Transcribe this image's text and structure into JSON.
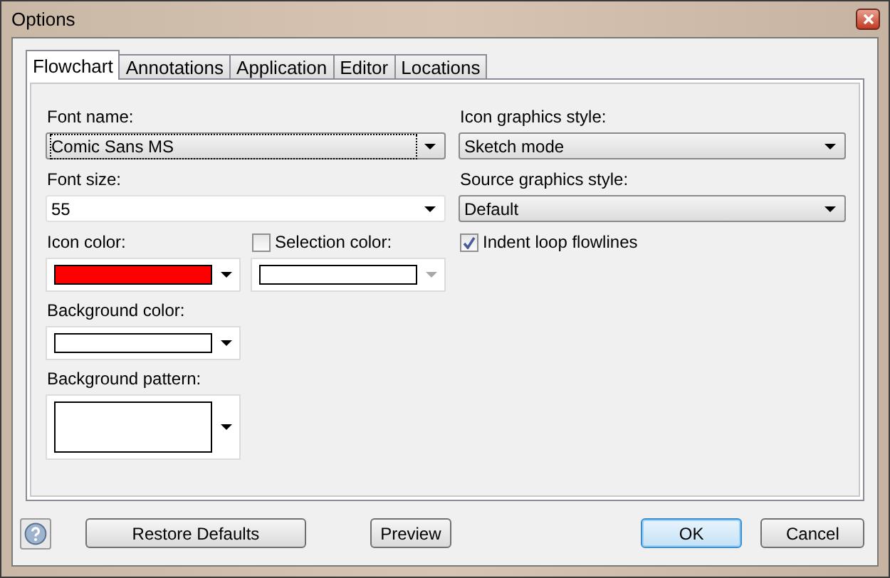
{
  "window": {
    "title": "Options"
  },
  "tabs": [
    {
      "label": "Flowchart",
      "selected": true
    },
    {
      "label": "Annotations",
      "selected": false
    },
    {
      "label": "Application",
      "selected": false
    },
    {
      "label": "Editor",
      "selected": false
    },
    {
      "label": "Locations",
      "selected": false
    }
  ],
  "font_name": {
    "label": "Font name:",
    "value": "Comic Sans MS",
    "focused": true
  },
  "font_size": {
    "label": "Font size:",
    "value": "55"
  },
  "icon_color": {
    "label": "Icon color:",
    "color": "#ff0000"
  },
  "selection_color": {
    "label": "Selection color:",
    "checked": false,
    "disabled": true,
    "color": "#ffffff"
  },
  "background_color": {
    "label": "Background color:",
    "color": "#ffffff"
  },
  "background_pattern": {
    "label": "Background pattern:",
    "color": "#ffffff"
  },
  "icon_graphics_style": {
    "label": "Icon graphics style:",
    "value": "Sketch mode"
  },
  "source_graphics_style": {
    "label": "Source graphics style:",
    "value": "Default"
  },
  "indent_loop_flowlines": {
    "label": "Indent loop flowlines",
    "checked": true
  },
  "buttons": [
    {
      "label": "Restore Defaults",
      "default": false
    },
    {
      "label": "Preview",
      "default": false
    },
    {
      "label": "OK",
      "default": true
    },
    {
      "label": "Cancel",
      "default": false
    }
  ]
}
